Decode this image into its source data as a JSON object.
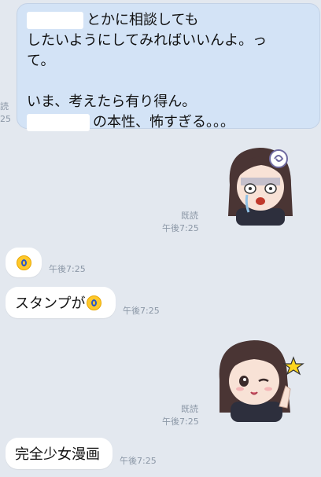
{
  "messages": {
    "m1": {
      "line1": "とかに相談しても",
      "line2": "したいようにしてみればいいんよ。っ",
      "line3": "て。",
      "line4": "いま、考えたら有り得ん。",
      "line5": "の本性、怖すぎる。。。"
    },
    "m1_meta": {
      "read": "読",
      "time": "25"
    },
    "s1_meta": {
      "read": "既読",
      "time": "午後7:25"
    },
    "e1_meta": {
      "time": "午後7:25"
    },
    "m2": {
      "text": "スタンプが",
      "time": "午後7:25"
    },
    "s2_meta": {
      "read": "既読",
      "time": "午後7:25"
    },
    "m3": {
      "text": "完全少女漫画",
      "time": "午後7:25"
    }
  },
  "stickers": {
    "s1": {
      "name": "anime-girl-sticker-crying"
    },
    "s2": {
      "name": "anime-girl-sticker-wink-star"
    }
  },
  "colors": {
    "background": "#e3e8ef",
    "outgoing_bubble": "#d3e3f6",
    "incoming_bubble": "#ffffff",
    "meta_text": "#8b97a6"
  }
}
